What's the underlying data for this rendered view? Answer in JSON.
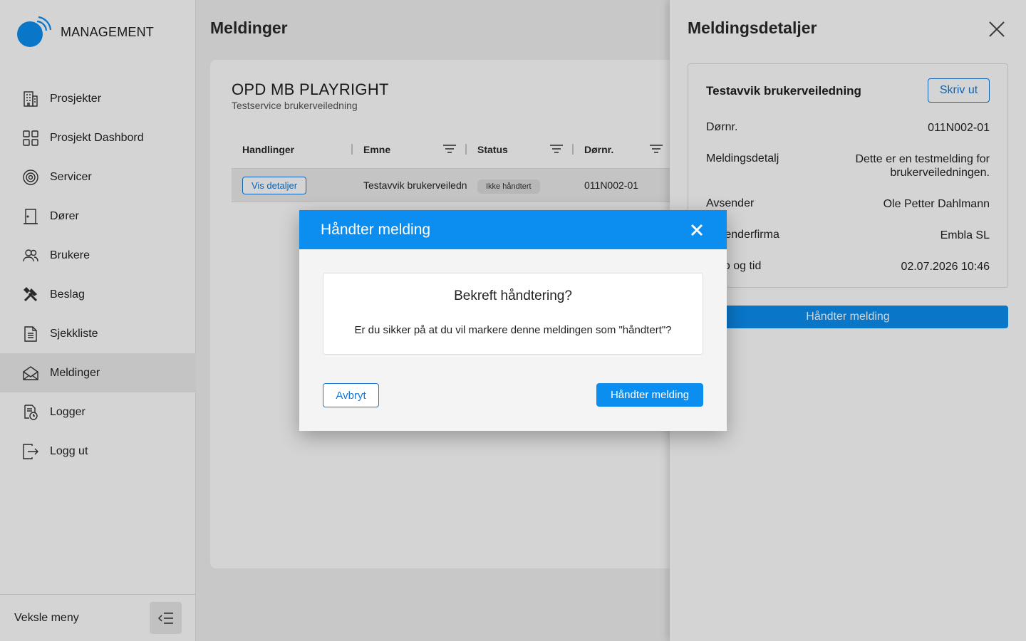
{
  "brand": {
    "name": "MANAGEMENT",
    "accent": "#0c8ef0"
  },
  "sidebar": {
    "items": [
      {
        "label": "Prosjekter",
        "icon": "building-icon"
      },
      {
        "label": "Prosjekt Dashbord",
        "icon": "grid-icon"
      },
      {
        "label": "Servicer",
        "icon": "service-icon"
      },
      {
        "label": "Dører",
        "icon": "door-icon"
      },
      {
        "label": "Brukere",
        "icon": "users-icon"
      },
      {
        "label": "Beslag",
        "icon": "tools-icon"
      },
      {
        "label": "Sjekkliste",
        "icon": "document-icon"
      },
      {
        "label": "Meldinger",
        "icon": "envelope-icon",
        "active": true
      },
      {
        "label": "Logger",
        "icon": "log-icon"
      },
      {
        "label": "Logg ut",
        "icon": "logout-icon"
      }
    ],
    "toggle_label": "Veksle meny"
  },
  "main": {
    "title": "Meldinger",
    "project": {
      "title": "OPD MB PLAYRIGHT",
      "subtitle": "Testservice brukerveiledning"
    },
    "table": {
      "columns": [
        "Handlinger",
        "Emne",
        "Status",
        "Dørnr."
      ],
      "rows": [
        {
          "action": "Vis detaljer",
          "subject": "Testavvik brukerveiledn",
          "status": "Ikke håndtert",
          "door": "011N002-01"
        }
      ]
    }
  },
  "panel": {
    "title": "Meldingsdetaljer",
    "detail_title": "Testavvik brukerveiledning",
    "print_label": "Skriv ut",
    "rows": [
      {
        "label": "Dørnr.",
        "value": "011N002-01"
      },
      {
        "label": "Meldingsdetalj",
        "value_line1": "Dette er en testmelding for",
        "value_line2": "brukerveiledningen."
      },
      {
        "label": "Avsender",
        "value": "Ole Petter Dahlmann"
      },
      {
        "label": "Avsenderfirma",
        "value": "Embla SL"
      },
      {
        "label": "Dato og tid",
        "value": "02.07.2026 10:46"
      }
    ],
    "handle_label": "Håndter melding"
  },
  "modal": {
    "title": "Håndter melding",
    "confirm_title": "Bekreft håndtering?",
    "confirm_text": "Er du sikker på at du vil markere denne meldingen som \"håndtert\"?",
    "cancel_label": "Avbryt",
    "confirm_label": "Håndter melding"
  }
}
